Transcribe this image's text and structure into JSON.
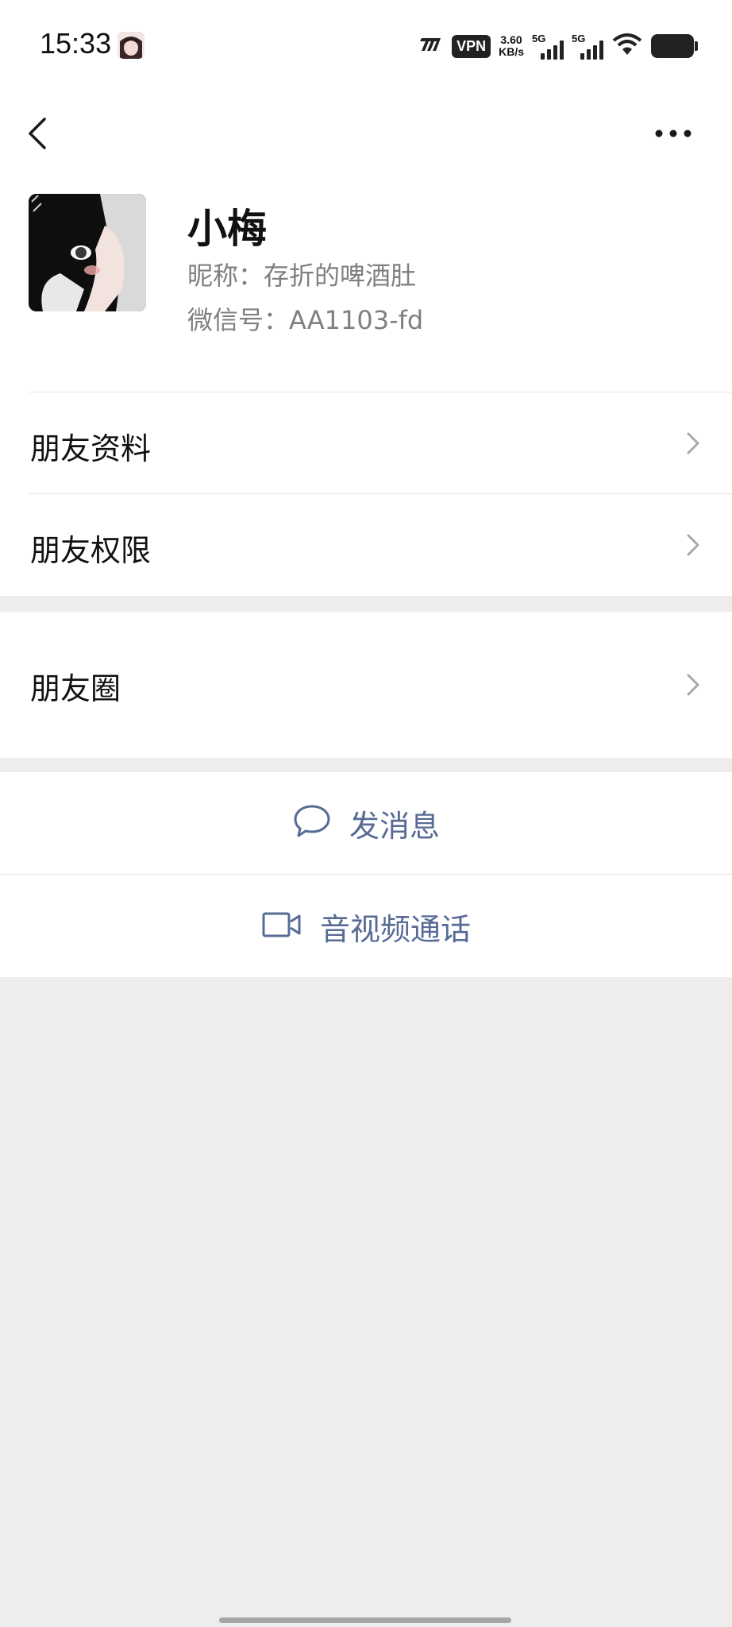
{
  "status_bar": {
    "time": "15:33",
    "vpn": "VPN",
    "speed_value": "3.60",
    "speed_unit": "KB/s",
    "signal1_label": "5G",
    "signal2_label": "5G",
    "icons": [
      "app-avatar-icon",
      "carrier-icon",
      "vpn-icon",
      "signal-icon",
      "wifi-icon",
      "battery-icon"
    ]
  },
  "nav": {
    "back_icon": "chevron-left-icon",
    "more_icon": "more-dots-icon"
  },
  "profile": {
    "name": "小梅",
    "nickname": "昵称：存折的啤酒肚",
    "wechat_id": "微信号：AA1103-fd"
  },
  "menu": {
    "items": [
      {
        "label": "朋友资料"
      },
      {
        "label": "朋友权限"
      },
      {
        "label": "朋友圈"
      }
    ]
  },
  "actions": {
    "message": "发消息",
    "call": "音视频通话"
  },
  "colors": {
    "link": "#576b95",
    "background": "#ededed",
    "card": "#ffffff",
    "secondary_text": "#7f7f7f"
  }
}
